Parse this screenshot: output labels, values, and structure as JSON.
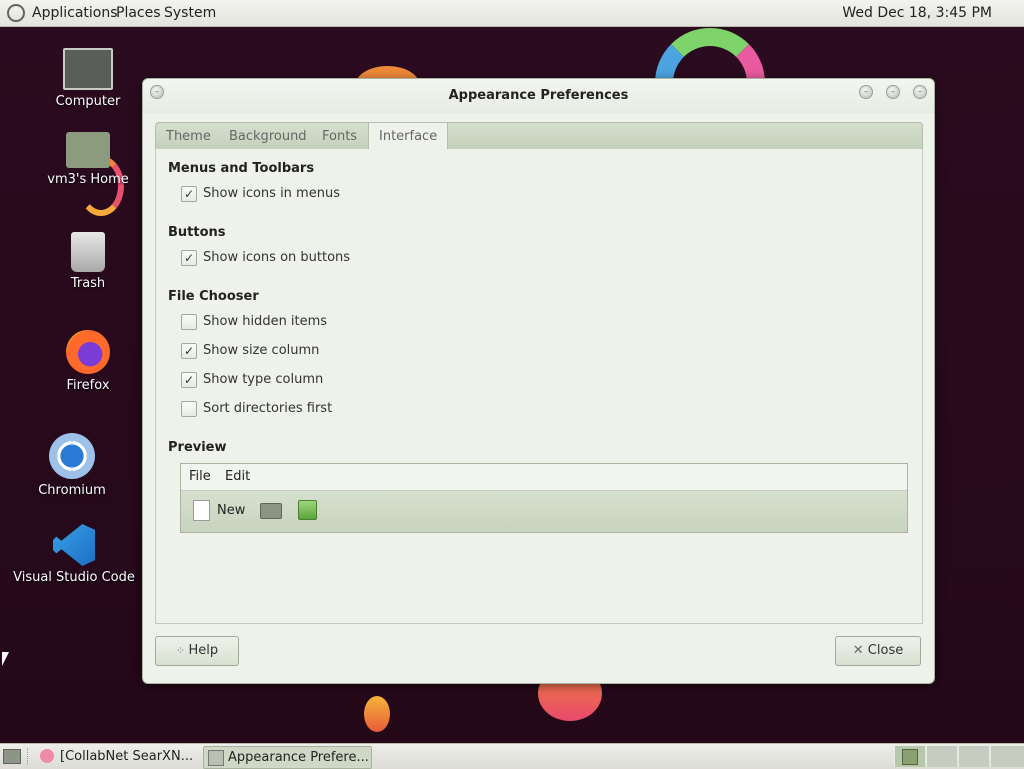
{
  "top_panel": {
    "menus": [
      "Applications",
      "Places",
      "System"
    ],
    "clock": "Wed Dec 18,  3:45 PM"
  },
  "desktop": {
    "icons": [
      {
        "label": "Computer",
        "icon": "computer-icon"
      },
      {
        "label": "vm3's Home",
        "icon": "home-folder-icon"
      },
      {
        "label": "Trash",
        "icon": "trash-icon"
      },
      {
        "label": "Firefox",
        "icon": "firefox-icon"
      },
      {
        "label": "Chromium",
        "icon": "chromium-icon"
      },
      {
        "label": "Visual Studio Code",
        "icon": "vscode-icon"
      }
    ]
  },
  "window": {
    "title": "Appearance Preferences",
    "tabs": [
      "Theme",
      "Background",
      "Fonts",
      "Interface"
    ],
    "active_tab": "Interface",
    "sections": {
      "menus_toolbars": {
        "title": "Menus and Toolbars",
        "options": [
          {
            "label": "Show icons in menus",
            "checked": true
          }
        ]
      },
      "buttons": {
        "title": "Buttons",
        "options": [
          {
            "label": "Show icons on buttons",
            "checked": true
          }
        ]
      },
      "file_chooser": {
        "title": "File Chooser",
        "options": [
          {
            "label": "Show hidden items",
            "checked": false
          },
          {
            "label": "Show size column",
            "checked": true
          },
          {
            "label": "Show type column",
            "checked": true
          },
          {
            "label": "Sort directories first",
            "checked": false
          }
        ]
      },
      "preview": {
        "title": "Preview",
        "menu": [
          "File",
          "Edit"
        ],
        "toolbar_new": "New"
      }
    },
    "help_label": "Help",
    "close_label": "Close"
  },
  "taskbar": {
    "tasks": [
      "[CollabNet SearXN...",
      "Appearance Prefere..."
    ]
  },
  "colors": {
    "accent": "#c8d4bf",
    "wallpaper": "#2a0c1c"
  }
}
